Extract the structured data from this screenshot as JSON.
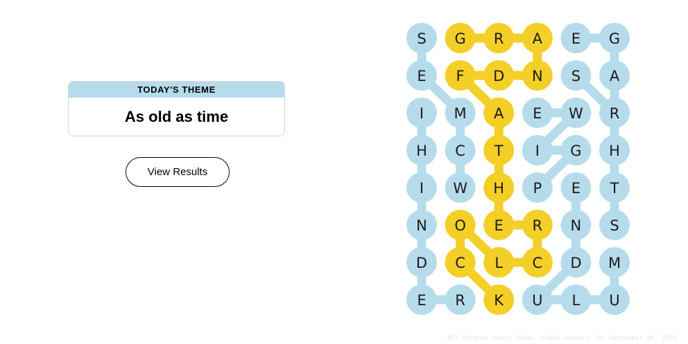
{
  "theme": {
    "header": "TODAY'S THEME",
    "title": "As old as time"
  },
  "results_button": {
    "label": "View Results"
  },
  "board": {
    "rows": 8,
    "cols": 6,
    "colors": {
      "found": "#b6dcec",
      "spangram": "#f3cf28"
    },
    "grid": [
      [
        "S",
        "G",
        "R",
        "A",
        "E",
        "G"
      ],
      [
        "E",
        "F",
        "D",
        "N",
        "S",
        "A"
      ],
      [
        "I",
        "M",
        "A",
        "E",
        "W",
        "R"
      ],
      [
        "H",
        "C",
        "T",
        "I",
        "G",
        "H"
      ],
      [
        "I",
        "W",
        "H",
        "P",
        "E",
        "T"
      ],
      [
        "N",
        "O",
        "E",
        "R",
        "N",
        "S"
      ],
      [
        "D",
        "C",
        "L",
        "C",
        "D",
        "M"
      ],
      [
        "E",
        "R",
        "K",
        "U",
        "L",
        "U"
      ]
    ],
    "words": [
      {
        "kind": "found",
        "path": [
          [
            0,
            0
          ],
          [
            1,
            0
          ],
          [
            2,
            1
          ],
          [
            3,
            1
          ],
          [
            4,
            1
          ]
        ]
      },
      {
        "kind": "found",
        "path": [
          [
            2,
            0
          ],
          [
            3,
            0
          ],
          [
            4,
            0
          ],
          [
            5,
            0
          ],
          [
            6,
            0
          ],
          [
            7,
            0
          ],
          [
            7,
            1
          ]
        ]
      },
      {
        "kind": "found",
        "path": [
          [
            0,
            4
          ],
          [
            0,
            5
          ],
          [
            1,
            5
          ],
          [
            2,
            5
          ],
          [
            3,
            5
          ],
          [
            4,
            5
          ],
          [
            5,
            5
          ]
        ]
      },
      {
        "kind": "found",
        "path": [
          [
            1,
            4
          ],
          [
            2,
            5
          ]
        ]
      },
      {
        "kind": "found",
        "path": [
          [
            2,
            3
          ],
          [
            2,
            4
          ],
          [
            3,
            3
          ],
          [
            3,
            4
          ],
          [
            4,
            3
          ]
        ]
      },
      {
        "kind": "found",
        "path": [
          [
            4,
            4
          ],
          [
            5,
            4
          ],
          [
            6,
            4
          ],
          [
            7,
            3
          ],
          [
            7,
            4
          ],
          [
            7,
            5
          ],
          [
            6,
            5
          ]
        ]
      },
      {
        "kind": "spangram",
        "path": [
          [
            0,
            1
          ],
          [
            0,
            2
          ],
          [
            0,
            3
          ],
          [
            1,
            3
          ],
          [
            1,
            2
          ],
          [
            1,
            1
          ],
          [
            2,
            2
          ],
          [
            3,
            2
          ],
          [
            4,
            2
          ],
          [
            5,
            2
          ],
          [
            5,
            3
          ],
          [
            6,
            3
          ],
          [
            6,
            2
          ],
          [
            5,
            1
          ],
          [
            6,
            1
          ],
          [
            7,
            2
          ]
        ]
      }
    ]
  },
  "watermark": "NYT Strands Hints Today, Check answers for September 26, 2025"
}
